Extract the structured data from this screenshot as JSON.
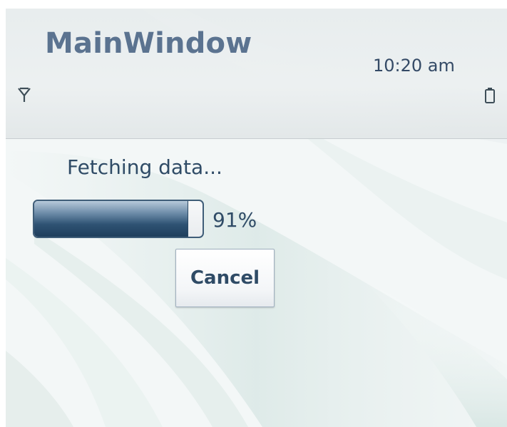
{
  "window": {
    "title": "MainWindow",
    "clock": "10:20 am"
  },
  "status_bar": {
    "signal_icon": "signal-antenna-icon",
    "battery_icon": "battery-icon"
  },
  "dialog": {
    "message": "Fetching data...",
    "progress": {
      "value": 91,
      "label": "91%"
    },
    "cancel_label": "Cancel"
  },
  "colors": {
    "title_text": "#5b7390",
    "body_text": "#2f4b66",
    "progress_fill": "#2f5374"
  }
}
